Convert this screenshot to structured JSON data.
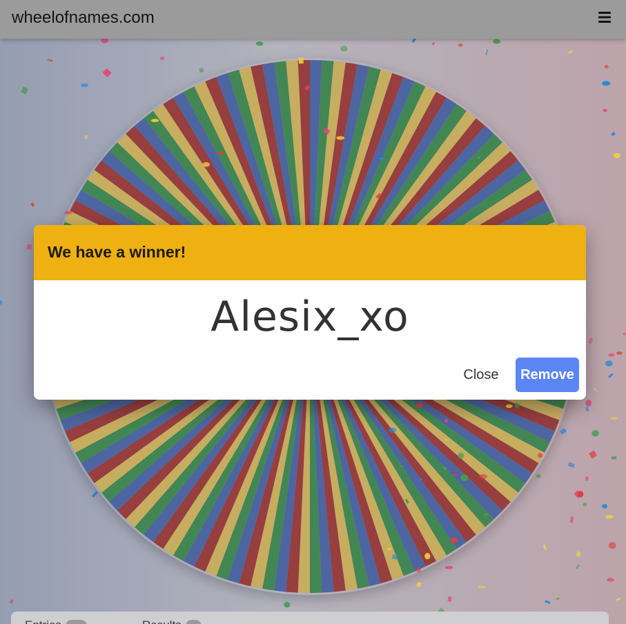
{
  "app": {
    "site_name": "wheelofnames.com",
    "menu_icon": "hamburger-menu-icon"
  },
  "wheel": {
    "segment_colors": [
      "#d32f2f",
      "#3f6ad8",
      "#1e9e3e",
      "#f2c230"
    ],
    "center_marker_color": "#ffffff"
  },
  "dialog": {
    "title": "We have a winner!",
    "winner": "Alesix_xo",
    "close_label": "Close",
    "remove_label": "Remove",
    "header_color": "#efb011",
    "remove_color": "#5c86f3"
  },
  "bottom_tabs": {
    "entries_label": "Entries",
    "results_label": "Results"
  },
  "confetti_colors": [
    "#e53935",
    "#1e88e5",
    "#43a047",
    "#fdd835",
    "#ec407a"
  ]
}
